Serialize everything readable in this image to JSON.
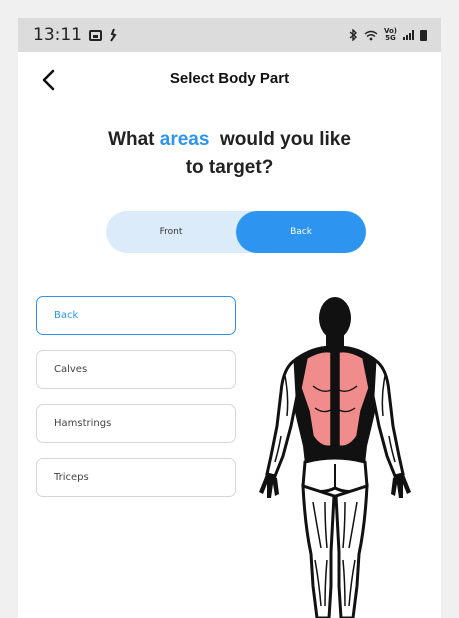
{
  "status": {
    "time": "13:11",
    "volte_top": "Vo)",
    "volte_bottom": "5G"
  },
  "header": {
    "title": "Select Body Part"
  },
  "question": {
    "line1_before": "What ",
    "accent": "areas",
    "line1_after": "  would you like",
    "line2": "to target?"
  },
  "toggle": {
    "front_label": "Front",
    "back_label": "Back",
    "selected": "Back"
  },
  "body_parts": {
    "items": [
      {
        "label": "Back",
        "selected": true
      },
      {
        "label": "Calves",
        "selected": false
      },
      {
        "label": "Hamstrings",
        "selected": false
      },
      {
        "label": "Triceps",
        "selected": false
      }
    ]
  },
  "colors": {
    "accent": "#2d95ef",
    "toggle_bg": "#dcebfa",
    "highlight_muscle": "#f08c8c"
  }
}
